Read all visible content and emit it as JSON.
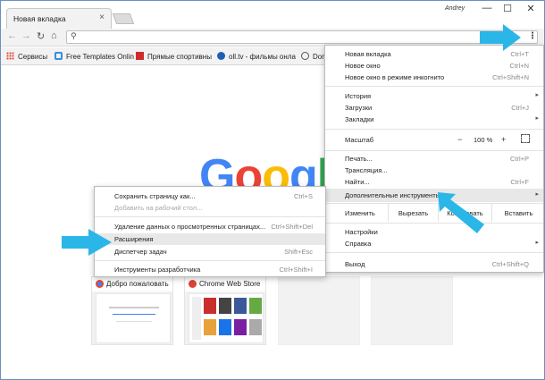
{
  "tab": {
    "title": "Новая вкладка",
    "close": "×"
  },
  "window": {
    "profile": "Andrey",
    "minimize": "—",
    "maximize": "☐",
    "close": "✕"
  },
  "toolbar": {
    "back": "←",
    "forward": "→",
    "reload": "↻",
    "home": "⌂",
    "search_icon": "⚲",
    "star": "☆",
    "menu": "⋮"
  },
  "bookmarks": [
    {
      "label": "Сервисы",
      "icon": "apps-icon",
      "color": "#e5483c"
    },
    {
      "label": "Free Templates Onlin",
      "icon": "ft-icon",
      "color": "#3a8ddc"
    },
    {
      "label": "Прямые спортивны",
      "icon": "sport-icon",
      "color": "#d02b2b"
    },
    {
      "label": "oll.tv - фильмы онла",
      "icon": "olltv-icon",
      "color": "#1e5fb4"
    },
    {
      "label": "Dom",
      "icon": "dom-icon",
      "color": "#555555"
    }
  ],
  "logo": [
    "G",
    "o",
    "o",
    "g",
    "l"
  ],
  "thumbs": [
    {
      "title": "Добро пожаловать",
      "fav_color": "#4285f4"
    },
    {
      "title": "Chrome Web Store",
      "fav_color": "#db4437"
    }
  ],
  "menu": {
    "new_tab": {
      "label": "Новая вкладка",
      "shortcut": "Ctrl+T"
    },
    "new_window": {
      "label": "Новое окно",
      "shortcut": "Ctrl+N"
    },
    "incognito": {
      "label": "Новое окно в режиме инкогнито",
      "shortcut": "Ctrl+Shift+N"
    },
    "history": {
      "label": "История",
      "arrow": "▸"
    },
    "downloads": {
      "label": "Загрузки",
      "shortcut": "Ctrl+J"
    },
    "bookmarks": {
      "label": "Закладки",
      "arrow": "▸"
    },
    "zoom": {
      "label": "Масштаб",
      "minus": "−",
      "value": "100 %",
      "plus": "+"
    },
    "print": {
      "label": "Печать...",
      "shortcut": "Ctrl+P"
    },
    "cast": {
      "label": "Трансляция..."
    },
    "find": {
      "label": "Найти...",
      "shortcut": "Ctrl+F"
    },
    "more_tools": {
      "label": "Дополнительные инструменты",
      "arrow": "▸"
    },
    "edit": {
      "label": "Изменить",
      "cut": "Вырезать",
      "copy": "Копировать",
      "paste": "Вставить"
    },
    "settings": {
      "label": "Настройки"
    },
    "help": {
      "label": "Справка",
      "arrow": "▸"
    },
    "exit": {
      "label": "Выход",
      "shortcut": "Ctrl+Shift+Q"
    }
  },
  "submenu": {
    "save_page": {
      "label": "Сохранить страницу как...",
      "shortcut": "Ctrl+S"
    },
    "add_desktop": {
      "label": "Добавить на рабочий стол..."
    },
    "clear_data": {
      "label": "Удаление данных о просмотренных страницах...",
      "shortcut": "Ctrl+Shift+Del"
    },
    "extensions": {
      "label": "Расширения"
    },
    "task_manager": {
      "label": "Диспетчер задач",
      "shortcut": "Shift+Esc"
    },
    "devtools": {
      "label": "Инструменты разработчика",
      "shortcut": "Ctrl+Shift+I"
    }
  },
  "colors": {
    "callout": "#2bb6e8",
    "highlight": "#e8e8e8"
  }
}
